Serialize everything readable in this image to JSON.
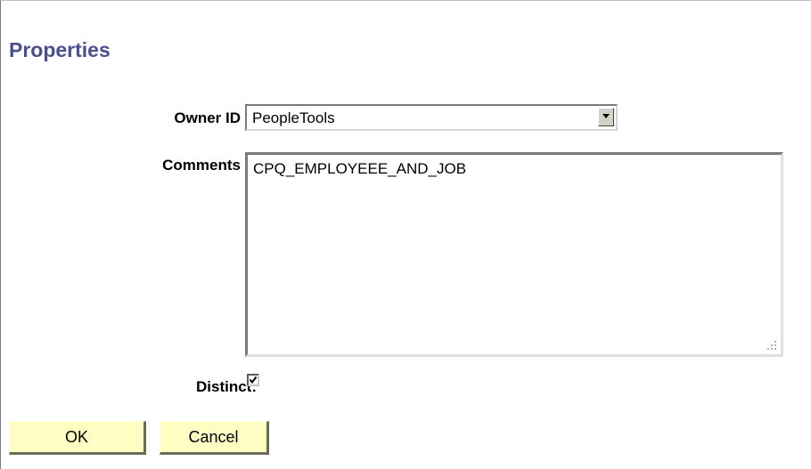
{
  "page": {
    "title": "Properties"
  },
  "form": {
    "owner_id": {
      "label": "Owner ID",
      "selected_value": "PeopleTools"
    },
    "comments": {
      "label": "Comments",
      "value": "CPQ_EMPLOYEEE_AND_JOB"
    },
    "distinct": {
      "label": "Distinct:",
      "checked": true
    }
  },
  "buttons": {
    "ok_label": "OK",
    "cancel_label": "Cancel"
  },
  "colors": {
    "title": "#4a4f8e",
    "button_face": "#ffffc4"
  },
  "icons": {
    "dropdown": "chevron-down-icon",
    "checkbox": "checkmark-icon",
    "resize": "resize-grip-icon"
  }
}
